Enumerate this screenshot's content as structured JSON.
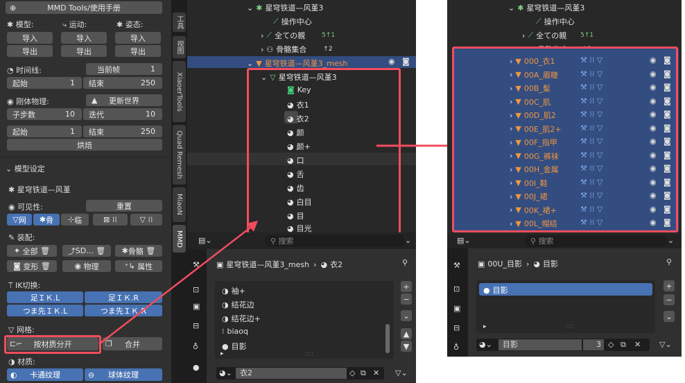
{
  "left": {
    "header": "MMD Tools/使用手册",
    "model_label": "模型:",
    "motion_label": "运动:",
    "pose_label": "姿态:",
    "import": "导入",
    "export": "导出",
    "timeline_label": "时间线:",
    "current_frame_btn": "当前帧",
    "current_frame_val": "1",
    "start_label": "起始",
    "start_val": "1",
    "end_label": "结束",
    "end_val": "250",
    "rigid_label": "刚体物理:",
    "update_world": "更新世界",
    "substeps_label": "子步数",
    "substeps_val": "10",
    "iter_label": "迭代",
    "iter_val": "10",
    "start2_val": "1",
    "end2_val": "250",
    "bake": "烘焙",
    "model_settings": "模型设定",
    "model_name": "星穹铁道—风堇",
    "visibility": "可见性:",
    "reset": "重置",
    "vis_mesh": "网",
    "vis_bone": "骨",
    "vis_temp": "临",
    "assembly": "装配:",
    "all": "全部",
    "sd": "SD...",
    "bone": "骨骼",
    "morph": "变形",
    "physics": "物理",
    "attr": "属性",
    "ik_switch": "IK切换:",
    "ik_foot_l": "足ＩＫ.L",
    "ik_foot_r": "足ＩＫ.R",
    "ik_toe_l": "つま先ＩＫ.L",
    "ik_toe_r": "つま先ＩＫ.R",
    "mesh_label": "网格:",
    "split_by_material": "按材质分开",
    "merge": "合并",
    "material_label": "材质:",
    "toon_tex": "卡通纹理",
    "sphere_tex": "球体纹理"
  },
  "tabs": [
    "工具",
    "视图",
    "XiaoerTools",
    "Quad Remesh",
    "MiaoN",
    "MMD"
  ],
  "mid": {
    "outliner": [
      "星穹铁道—风堇3",
      "操作中心",
      "全ての親",
      "骨骼集合"
    ],
    "badge1": "5↑1",
    "badge2": "↑2",
    "mesh_obj": "星穹铁道—风堇3_mesh",
    "data_name": "星穹铁道—风堇3",
    "shape_key": "Key",
    "materials": [
      "衣1",
      "衣2",
      "颜",
      "颜+",
      "口",
      "舌",
      "齿",
      "白目",
      "目",
      "目光"
    ],
    "search_placeholder": "搜索",
    "breadcrumb_obj": "星穹铁道—风堇3_mesh",
    "breadcrumb_mat": "衣2",
    "mat_list": [
      "袖+",
      "结花边",
      "结花边+",
      "biaoq",
      "目影"
    ],
    "mat_field": "衣2"
  },
  "right": {
    "header": "星穹铁道—风堇3",
    "items": [
      "操作中心",
      "全ての親",
      "骨骼集合"
    ],
    "badge1": "5↑1",
    "badge2": "↑2",
    "objects": [
      "000_衣1",
      "00A_眉睫",
      "00B_髪",
      "00C_肌",
      "00D_肌2",
      "00E_肌2+",
      "00F_指甲",
      "00G_裤袜",
      "00H_金属",
      "00I_鞋",
      "00J_裙",
      "00K_裙+",
      "00L_帽结"
    ],
    "search_placeholder": "搜索",
    "breadcrumb_obj": "00U_目影",
    "breadcrumb_mat": "目影",
    "mat_item": "目影",
    "mat_field": "目影",
    "users": "3"
  },
  "colors": {
    "accent": "#4772b3",
    "highlight": "#f24d5e",
    "mesh_orange": "#f09642",
    "selected_row": "#334d80"
  }
}
